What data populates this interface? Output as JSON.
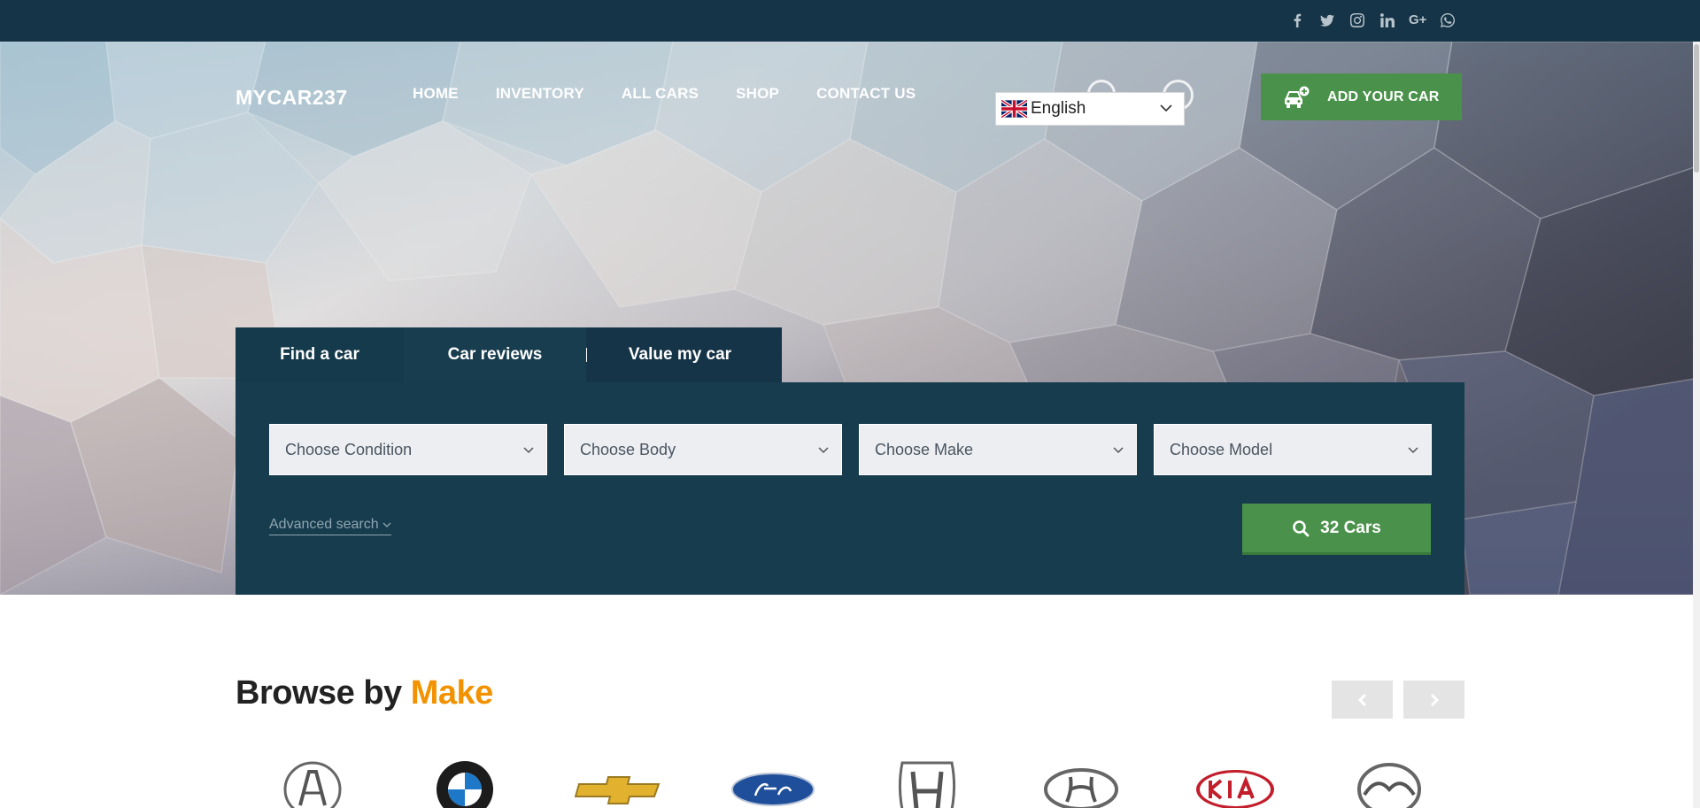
{
  "social": {
    "icons": [
      "facebook-icon",
      "twitter-icon",
      "instagram-icon",
      "linkedin-icon",
      "google-plus-icon",
      "whatsapp-icon"
    ],
    "googleplus_label": "G+"
  },
  "header": {
    "logo": "MYCAR237",
    "nav": [
      "HOME",
      "INVENTORY",
      "ALL CARS",
      "SHOP",
      "CONTACT US"
    ],
    "language": "English",
    "add_car": "ADD YOUR CAR"
  },
  "search": {
    "tabs": [
      "Find a car",
      "Car reviews",
      "Value my car"
    ],
    "active_tab": "Find a car",
    "selects": [
      "Choose Condition",
      "Choose Body",
      "Choose Make",
      "Choose Model"
    ],
    "advanced": "Advanced search",
    "button": "32 Cars"
  },
  "browse": {
    "title": "Browse by",
    "accent": "Make",
    "makes": [
      "Acura",
      "BMW",
      "Chevrolet",
      "Ford",
      "Honda",
      "Hyundai",
      "Kia",
      "Mazda"
    ]
  },
  "colors": {
    "dark_navy": "#163447",
    "panel": "#173c4d",
    "green": "#4a924b",
    "accent_orange": "#f39200"
  }
}
